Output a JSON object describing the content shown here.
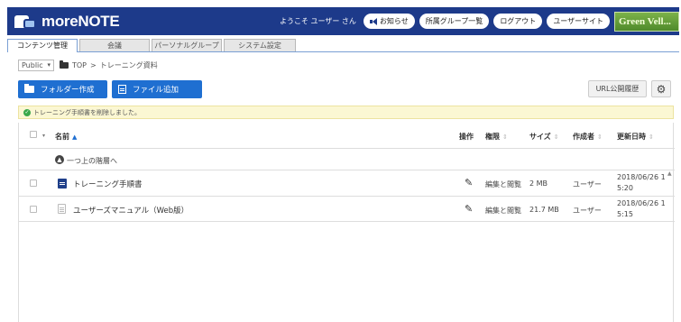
{
  "header": {
    "logo_text": "moreNOTE",
    "welcome": "ようこそ ユーザー さん",
    "buttons": [
      "お知らせ",
      "所属グループ一覧",
      "ログアウト",
      "ユーザーサイト"
    ],
    "green_logo": "Green Vell..."
  },
  "tabs": [
    "コンテンツ管理",
    "会議",
    "パーソナルグループ",
    "システム設定"
  ],
  "breadcrumb": {
    "scope": "Public",
    "root": "TOP",
    "separator": ">",
    "current": "トレーニング資料"
  },
  "actions": {
    "create_folder": "フォルダー作成",
    "add_file": "ファイル追加",
    "url_history": "URL公開履歴"
  },
  "notice": "トレーニング手順書を削除しました。",
  "table": {
    "columns": {
      "name": "名前",
      "ops": "操作",
      "perm": "権限",
      "size": "サイズ",
      "author": "作成者",
      "updated": "更新日時"
    },
    "up_label": "一つ上の階層へ",
    "rows": [
      {
        "name": "トレーニング手順書",
        "icon": "document-icon",
        "perm": "編集と閲覧",
        "size": "2 MB",
        "author": "ユーザー",
        "updated_line1": "2018/06/26 1",
        "updated_line2": "5:20"
      },
      {
        "name": "ユーザーズマニュアル（Web版）",
        "icon": "web-document-icon",
        "perm": "編集と閲覧",
        "size": "21.7 MB",
        "author": "ユーザー",
        "updated_line1": "2018/06/26 1",
        "updated_line2": "5:15"
      }
    ]
  },
  "colors": {
    "header_bg": "#1d3a8a",
    "primary_button": "#1f6fd1",
    "notice_bg": "#fbf7d3",
    "success": "#3aa84a"
  }
}
